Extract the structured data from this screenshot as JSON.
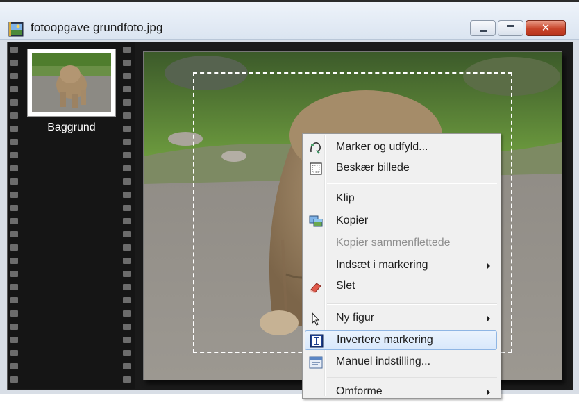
{
  "window": {
    "title": "fotoopgave grundfoto.jpg",
    "icon": "image-file-icon",
    "controls": {
      "minimize": "minimize-icon",
      "maximize": "maximize-icon",
      "close": "close-icon",
      "close_glyph": "✕"
    }
  },
  "layers": [
    {
      "label": "Baggrund",
      "thumbnail": "lion-cub-thumbnail"
    }
  ],
  "canvas": {
    "image": "lion-cub-photo",
    "selection": "dashed-rectangle-marquee"
  },
  "context_menu": {
    "items": [
      {
        "label": "Marker og udfyld...",
        "icon": "lasso-fill-icon",
        "enabled": true,
        "submenu": false
      },
      {
        "label": "Beskær billede",
        "icon": "crop-icon",
        "enabled": true,
        "submenu": false
      },
      {
        "label": "Klip",
        "icon": "",
        "enabled": true,
        "submenu": false
      },
      {
        "label": "Kopier",
        "icon": "copy-image-icon",
        "enabled": true,
        "submenu": false
      },
      {
        "label": "Kopier sammenflettede",
        "icon": "",
        "enabled": false,
        "submenu": false
      },
      {
        "label": "Indsæt i markering",
        "icon": "",
        "enabled": true,
        "submenu": true
      },
      {
        "label": "Slet",
        "icon": "eraser-icon",
        "enabled": true,
        "submenu": false
      },
      {
        "label": "Ny figur",
        "icon": "pointer-icon",
        "enabled": true,
        "submenu": true
      },
      {
        "label": "Invertere markering",
        "icon": "invert-selection-icon",
        "enabled": true,
        "submenu": false,
        "highlighted": true
      },
      {
        "label": "Manuel indstilling...",
        "icon": "manual-settings-icon",
        "enabled": true,
        "submenu": false
      },
      {
        "label": "Omforme",
        "icon": "",
        "enabled": true,
        "submenu": true
      }
    ]
  },
  "colors": {
    "menu_highlight": "#d9e8fb",
    "menu_highlight_border": "#8fb6e4",
    "close_button": "#c8442a",
    "filmstrip_bg": "#151515"
  }
}
